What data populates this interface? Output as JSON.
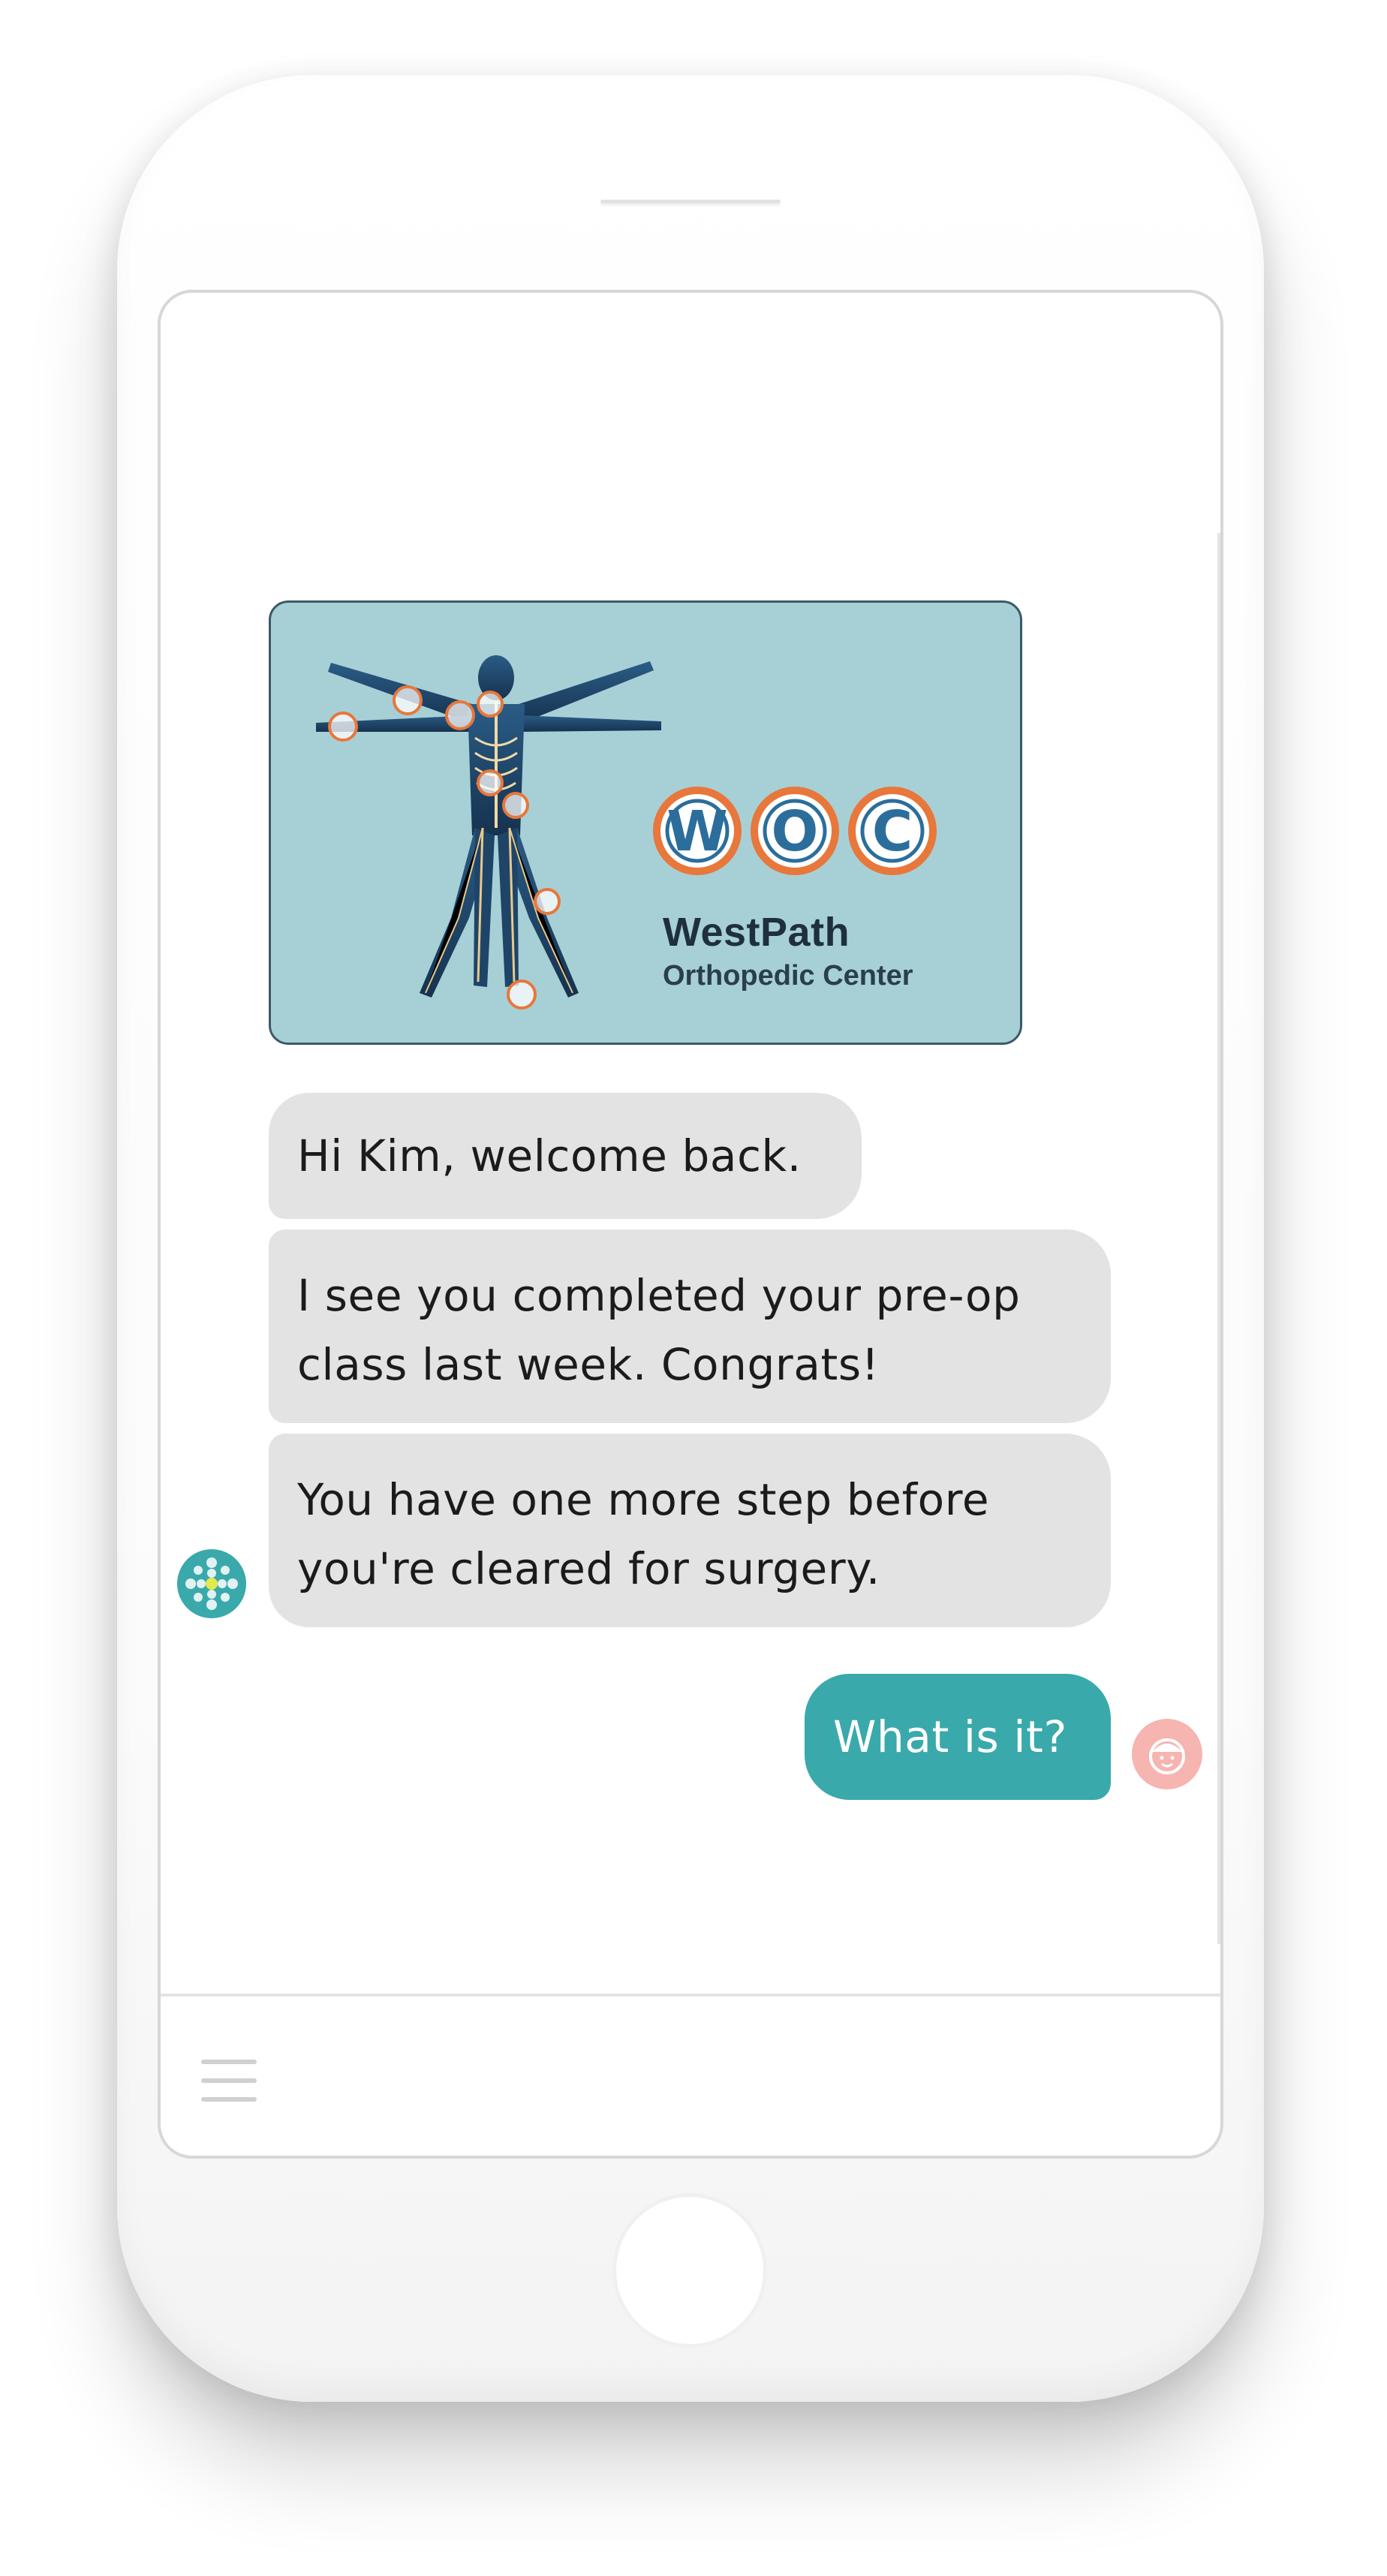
{
  "brand": {
    "logo_letters": [
      "W",
      "O",
      "C"
    ],
    "name": "WestPath",
    "subtitle": "Orthopedic Center"
  },
  "conversation": {
    "messages": [
      {
        "sender": "bot",
        "lines": [
          "Hi Kim, welcome back."
        ]
      },
      {
        "sender": "bot",
        "lines": [
          "I see you completed your pre-op",
          "class last week. Congrats!"
        ]
      },
      {
        "sender": "bot",
        "lines": [
          "You have one more step before",
          "you're cleared for surgery."
        ]
      },
      {
        "sender": "user",
        "lines": [
          "What is it?"
        ]
      }
    ]
  },
  "composer": {
    "menu_icon": "hamburger-menu-icon"
  },
  "colors": {
    "bot_bubble": "#e3e3e3",
    "user_bubble": "#3aa9ab",
    "logo_background": "#a7d0d6",
    "logo_ring": "#e8773b",
    "user_avatar": "#f6b5b0",
    "bot_avatar": "#3aa9ab"
  }
}
